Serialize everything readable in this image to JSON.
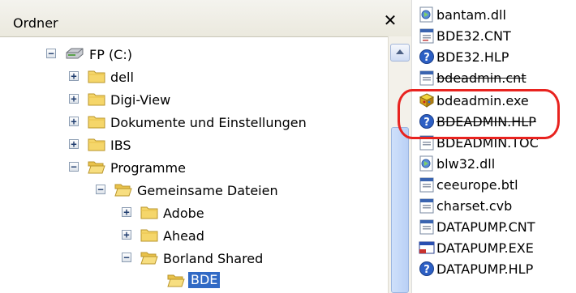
{
  "folder_pane": {
    "title": "Ordner",
    "close": "✕",
    "tree": [
      {
        "label": "FP (C:)",
        "expander": "−"
      },
      {
        "label": "dell",
        "expander": "+"
      },
      {
        "label": "Digi-View",
        "expander": "+"
      },
      {
        "label": "Dokumente und Einstellungen",
        "expander": "+"
      },
      {
        "label": "IBS",
        "expander": "+"
      },
      {
        "label": "Programme",
        "expander": "−"
      },
      {
        "label": "Gemeinsame Dateien",
        "expander": "−"
      },
      {
        "label": "Adobe",
        "expander": "+"
      },
      {
        "label": "Ahead",
        "expander": "+"
      },
      {
        "label": "Borland Shared",
        "expander": "−"
      },
      {
        "label": "BDE",
        "expander": ""
      }
    ]
  },
  "file_list": {
    "files": [
      {
        "name": "bantam.dll",
        "icon": "dll-icon"
      },
      {
        "name": "BDE32.CNT",
        "icon": "cnt-icon"
      },
      {
        "name": "BDE32.HLP",
        "icon": "help-icon"
      },
      {
        "name": "bdeadmin.cnt",
        "icon": "cnt-icon"
      },
      {
        "name": "bdeadmin.exe",
        "icon": "exe-icon"
      },
      {
        "name": "BDEADMIN.HLP",
        "icon": "help-icon"
      },
      {
        "name": "BDEADMIN.TOC",
        "icon": "cnt-icon"
      },
      {
        "name": "blw32.dll",
        "icon": "dll-icon"
      },
      {
        "name": "ceeurope.btl",
        "icon": "cnt-icon"
      },
      {
        "name": "charset.cvb",
        "icon": "cnt-icon"
      },
      {
        "name": "DATAPUMP.CNT",
        "icon": "cnt-icon"
      },
      {
        "name": "DATAPUMP.EXE",
        "icon": "app-icon"
      },
      {
        "name": "DATAPUMP.HLP",
        "icon": "help-icon"
      }
    ]
  },
  "colors": {
    "selection": "#316ac5",
    "annotation": "#e8231f",
    "folder": "#f5d66a"
  }
}
